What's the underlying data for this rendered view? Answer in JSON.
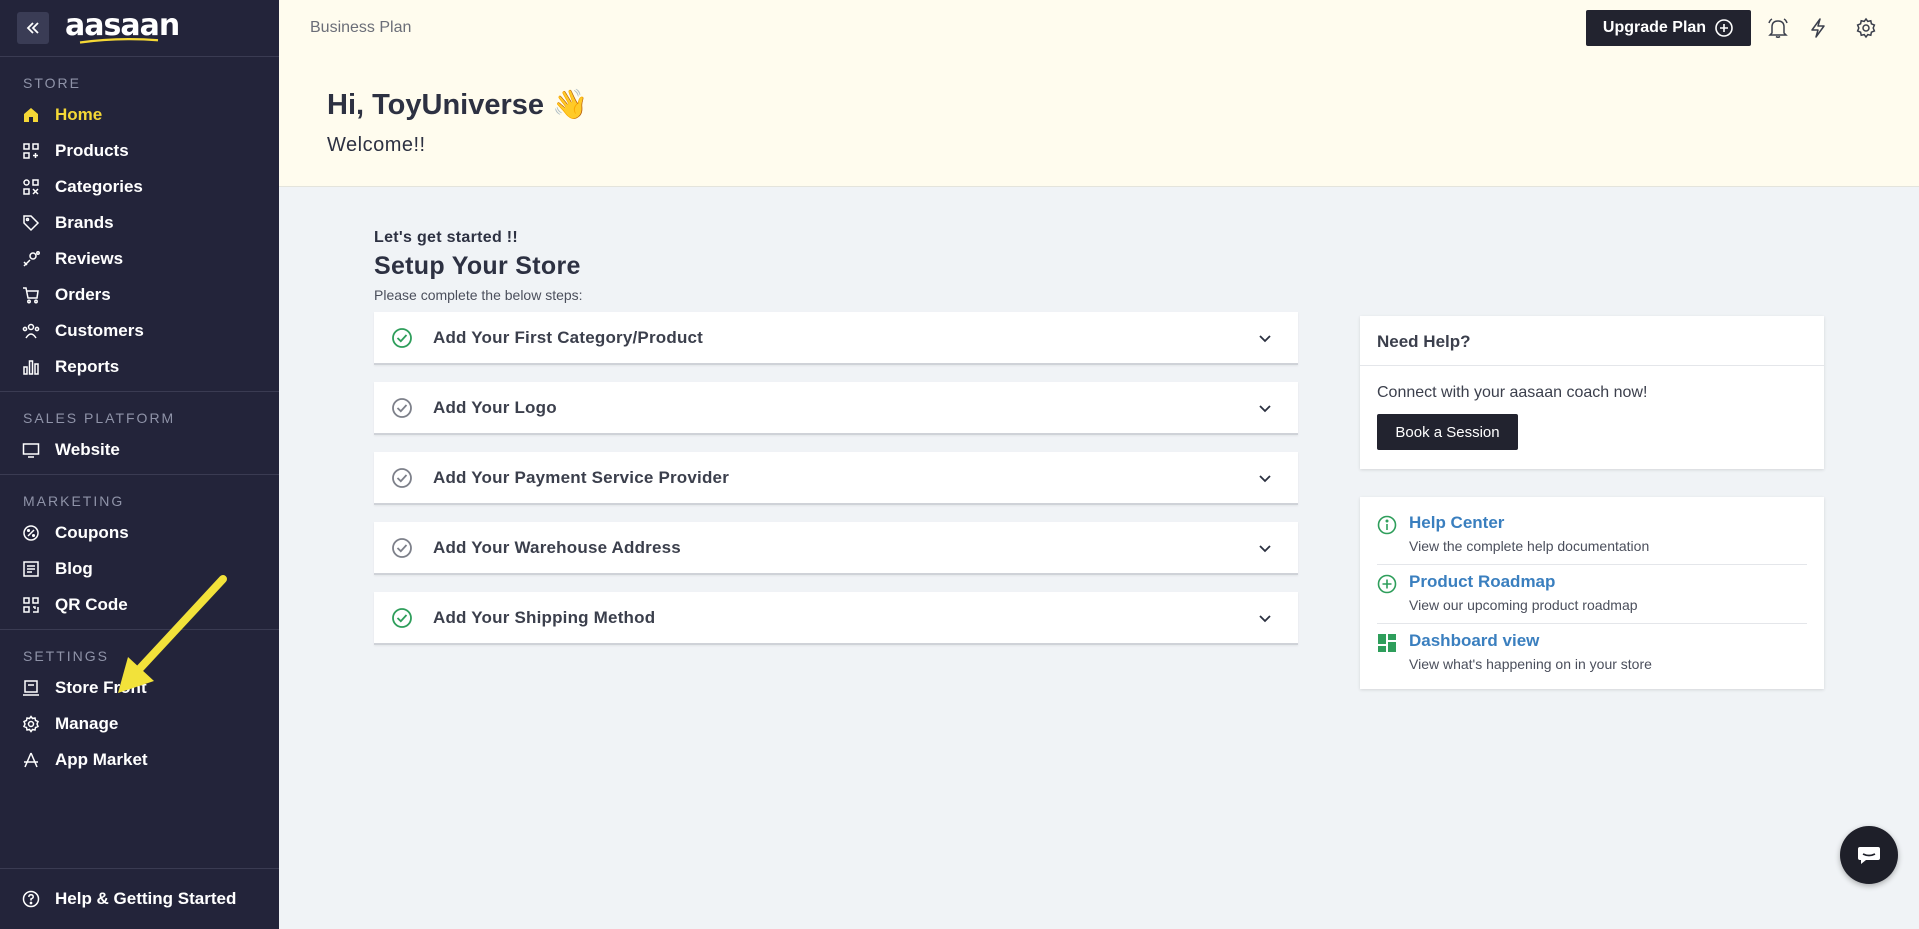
{
  "brand": {
    "name": "aasaan"
  },
  "sidebar": {
    "sections": [
      {
        "label": "STORE",
        "items": [
          {
            "label": "Home",
            "icon": "home-icon",
            "active": true
          },
          {
            "label": "Products",
            "icon": "products-icon"
          },
          {
            "label": "Categories",
            "icon": "categories-icon"
          },
          {
            "label": "Brands",
            "icon": "tag-icon"
          },
          {
            "label": "Reviews",
            "icon": "reviews-icon"
          },
          {
            "label": "Orders",
            "icon": "cart-icon"
          },
          {
            "label": "Customers",
            "icon": "customers-icon"
          },
          {
            "label": "Reports",
            "icon": "bar-chart-icon"
          }
        ]
      },
      {
        "label": "SALES PLATFORM",
        "items": [
          {
            "label": "Website",
            "icon": "monitor-icon"
          }
        ]
      },
      {
        "label": "MARKETING",
        "items": [
          {
            "label": "Coupons",
            "icon": "coupon-icon"
          },
          {
            "label": "Blog",
            "icon": "blog-icon"
          },
          {
            "label": "QR Code",
            "icon": "qr-code-icon"
          }
        ]
      },
      {
        "label": "SETTINGS",
        "items": [
          {
            "label": "Store Front",
            "icon": "store-front-icon"
          },
          {
            "label": "Manage",
            "icon": "gear-icon"
          },
          {
            "label": "App Market",
            "icon": "app-market-icon"
          }
        ]
      }
    ],
    "footer": {
      "label": "Help & Getting Started",
      "icon": "help-circle-icon"
    }
  },
  "header": {
    "plan": "Business Plan",
    "upgrade_label": "Upgrade Plan",
    "greeting": "Hi, ToyUniverse 👋",
    "welcome": "Welcome!!"
  },
  "setup": {
    "kicker": "Let's get started !!",
    "title": "Setup Your Store",
    "subtitle": "Please complete the below steps:",
    "steps": [
      {
        "label": "Add Your First Category/Product",
        "done": true
      },
      {
        "label": "Add Your Logo",
        "done": false
      },
      {
        "label": "Add Your Payment Service Provider",
        "done": false
      },
      {
        "label": "Add Your Warehouse Address",
        "done": false
      },
      {
        "label": "Add Your Shipping Method",
        "done": true
      }
    ]
  },
  "help": {
    "title": "Need Help?",
    "text": "Connect with your aasaan coach now!",
    "button": "Book a Session"
  },
  "links": [
    {
      "title": "Help Center",
      "desc": "View the complete help documentation",
      "icon": "info-icon"
    },
    {
      "title": "Product Roadmap",
      "desc": "View our upcoming product roadmap",
      "icon": "plus-circle-icon"
    },
    {
      "title": "Dashboard view",
      "desc": "View what's happening on in your store",
      "icon": "dashboard-icon"
    }
  ],
  "colors": {
    "sidebar_bg": "#23243a",
    "accent": "#f5d836",
    "header_bg": "#fffcee",
    "link": "#3a7fbf",
    "success": "#2e9e5b"
  }
}
